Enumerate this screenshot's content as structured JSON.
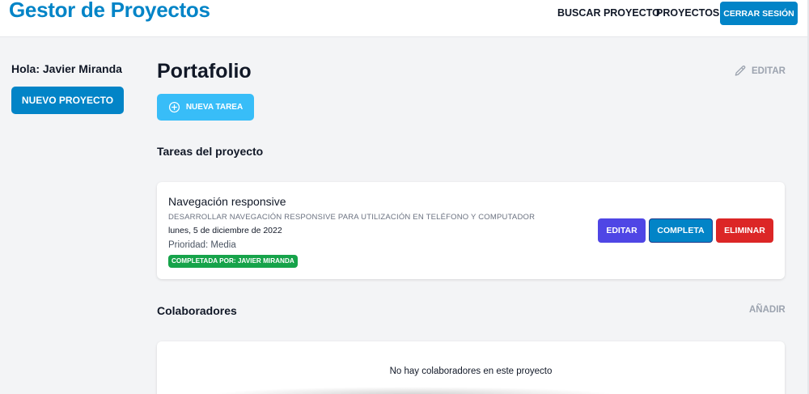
{
  "header": {
    "brand": "Gestor de Proyectos",
    "nav": {
      "search": "BUSCAR PROYECTO",
      "projects": "PROYECTOS"
    },
    "logout_label": "CERRAR SESIÓN"
  },
  "sidebar": {
    "greeting": "Hola: Javier Miranda",
    "new_project_label": "NUEVO PROYECTO"
  },
  "project": {
    "title": "Portafolio",
    "edit_label": "EDITAR",
    "new_task_label": "NUEVA TAREA",
    "tasks_title": "Tareas del proyecto",
    "tasks": [
      {
        "name": "Navegación responsive",
        "description": "DESARROLLAR NAVEGACIÓN RESPONSIVE PARA UTILIZACIÓN EN TELÉFONO Y COMPUTADOR",
        "date": "lunes, 5 de diciembre de 2022",
        "priority": "Prioridad: Media",
        "completed_by": "COMPLETADA POR: JAVIER MIRANDA",
        "actions": {
          "edit": "EDITAR",
          "complete": "COMPLETA",
          "delete": "ELIMINAR"
        }
      }
    ],
    "collaborators_title": "Colaboradores",
    "add_label": "AÑADIR",
    "no_collaborators": "No hay colaboradores en este proyecto"
  },
  "colors": {
    "primary": "#0284c7",
    "sky": "#38bdf8",
    "indigo": "#4f46e5",
    "danger": "#dc2626",
    "success": "#16a34a"
  },
  "icons": {
    "edit": "pencil-icon",
    "new_task": "plus-circle-icon"
  }
}
